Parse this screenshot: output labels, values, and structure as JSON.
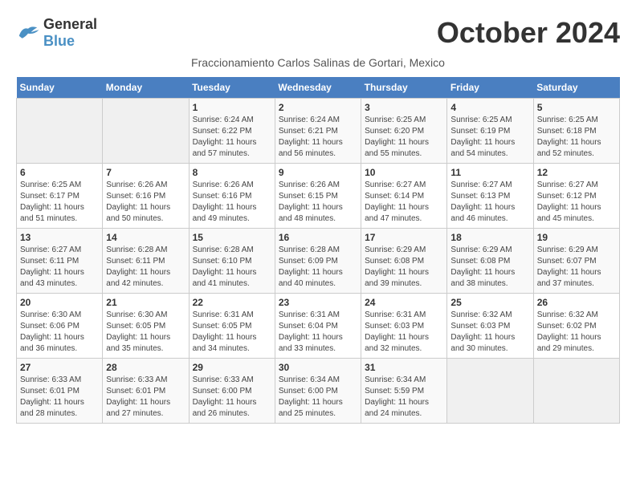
{
  "logo": {
    "line1": "General",
    "line2": "Blue"
  },
  "title": "October 2024",
  "subtitle": "Fraccionamiento Carlos Salinas de Gortari, Mexico",
  "days_of_week": [
    "Sunday",
    "Monday",
    "Tuesday",
    "Wednesday",
    "Thursday",
    "Friday",
    "Saturday"
  ],
  "weeks": [
    [
      {
        "day": "",
        "sunrise": "",
        "sunset": "",
        "daylight": ""
      },
      {
        "day": "",
        "sunrise": "",
        "sunset": "",
        "daylight": ""
      },
      {
        "day": "1",
        "sunrise": "Sunrise: 6:24 AM",
        "sunset": "Sunset: 6:22 PM",
        "daylight": "Daylight: 11 hours and 57 minutes."
      },
      {
        "day": "2",
        "sunrise": "Sunrise: 6:24 AM",
        "sunset": "Sunset: 6:21 PM",
        "daylight": "Daylight: 11 hours and 56 minutes."
      },
      {
        "day": "3",
        "sunrise": "Sunrise: 6:25 AM",
        "sunset": "Sunset: 6:20 PM",
        "daylight": "Daylight: 11 hours and 55 minutes."
      },
      {
        "day": "4",
        "sunrise": "Sunrise: 6:25 AM",
        "sunset": "Sunset: 6:19 PM",
        "daylight": "Daylight: 11 hours and 54 minutes."
      },
      {
        "day": "5",
        "sunrise": "Sunrise: 6:25 AM",
        "sunset": "Sunset: 6:18 PM",
        "daylight": "Daylight: 11 hours and 52 minutes."
      }
    ],
    [
      {
        "day": "6",
        "sunrise": "Sunrise: 6:25 AM",
        "sunset": "Sunset: 6:17 PM",
        "daylight": "Daylight: 11 hours and 51 minutes."
      },
      {
        "day": "7",
        "sunrise": "Sunrise: 6:26 AM",
        "sunset": "Sunset: 6:16 PM",
        "daylight": "Daylight: 11 hours and 50 minutes."
      },
      {
        "day": "8",
        "sunrise": "Sunrise: 6:26 AM",
        "sunset": "Sunset: 6:16 PM",
        "daylight": "Daylight: 11 hours and 49 minutes."
      },
      {
        "day": "9",
        "sunrise": "Sunrise: 6:26 AM",
        "sunset": "Sunset: 6:15 PM",
        "daylight": "Daylight: 11 hours and 48 minutes."
      },
      {
        "day": "10",
        "sunrise": "Sunrise: 6:27 AM",
        "sunset": "Sunset: 6:14 PM",
        "daylight": "Daylight: 11 hours and 47 minutes."
      },
      {
        "day": "11",
        "sunrise": "Sunrise: 6:27 AM",
        "sunset": "Sunset: 6:13 PM",
        "daylight": "Daylight: 11 hours and 46 minutes."
      },
      {
        "day": "12",
        "sunrise": "Sunrise: 6:27 AM",
        "sunset": "Sunset: 6:12 PM",
        "daylight": "Daylight: 11 hours and 45 minutes."
      }
    ],
    [
      {
        "day": "13",
        "sunrise": "Sunrise: 6:27 AM",
        "sunset": "Sunset: 6:11 PM",
        "daylight": "Daylight: 11 hours and 43 minutes."
      },
      {
        "day": "14",
        "sunrise": "Sunrise: 6:28 AM",
        "sunset": "Sunset: 6:11 PM",
        "daylight": "Daylight: 11 hours and 42 minutes."
      },
      {
        "day": "15",
        "sunrise": "Sunrise: 6:28 AM",
        "sunset": "Sunset: 6:10 PM",
        "daylight": "Daylight: 11 hours and 41 minutes."
      },
      {
        "day": "16",
        "sunrise": "Sunrise: 6:28 AM",
        "sunset": "Sunset: 6:09 PM",
        "daylight": "Daylight: 11 hours and 40 minutes."
      },
      {
        "day": "17",
        "sunrise": "Sunrise: 6:29 AM",
        "sunset": "Sunset: 6:08 PM",
        "daylight": "Daylight: 11 hours and 39 minutes."
      },
      {
        "day": "18",
        "sunrise": "Sunrise: 6:29 AM",
        "sunset": "Sunset: 6:08 PM",
        "daylight": "Daylight: 11 hours and 38 minutes."
      },
      {
        "day": "19",
        "sunrise": "Sunrise: 6:29 AM",
        "sunset": "Sunset: 6:07 PM",
        "daylight": "Daylight: 11 hours and 37 minutes."
      }
    ],
    [
      {
        "day": "20",
        "sunrise": "Sunrise: 6:30 AM",
        "sunset": "Sunset: 6:06 PM",
        "daylight": "Daylight: 11 hours and 36 minutes."
      },
      {
        "day": "21",
        "sunrise": "Sunrise: 6:30 AM",
        "sunset": "Sunset: 6:05 PM",
        "daylight": "Daylight: 11 hours and 35 minutes."
      },
      {
        "day": "22",
        "sunrise": "Sunrise: 6:31 AM",
        "sunset": "Sunset: 6:05 PM",
        "daylight": "Daylight: 11 hours and 34 minutes."
      },
      {
        "day": "23",
        "sunrise": "Sunrise: 6:31 AM",
        "sunset": "Sunset: 6:04 PM",
        "daylight": "Daylight: 11 hours and 33 minutes."
      },
      {
        "day": "24",
        "sunrise": "Sunrise: 6:31 AM",
        "sunset": "Sunset: 6:03 PM",
        "daylight": "Daylight: 11 hours and 32 minutes."
      },
      {
        "day": "25",
        "sunrise": "Sunrise: 6:32 AM",
        "sunset": "Sunset: 6:03 PM",
        "daylight": "Daylight: 11 hours and 30 minutes."
      },
      {
        "day": "26",
        "sunrise": "Sunrise: 6:32 AM",
        "sunset": "Sunset: 6:02 PM",
        "daylight": "Daylight: 11 hours and 29 minutes."
      }
    ],
    [
      {
        "day": "27",
        "sunrise": "Sunrise: 6:33 AM",
        "sunset": "Sunset: 6:01 PM",
        "daylight": "Daylight: 11 hours and 28 minutes."
      },
      {
        "day": "28",
        "sunrise": "Sunrise: 6:33 AM",
        "sunset": "Sunset: 6:01 PM",
        "daylight": "Daylight: 11 hours and 27 minutes."
      },
      {
        "day": "29",
        "sunrise": "Sunrise: 6:33 AM",
        "sunset": "Sunset: 6:00 PM",
        "daylight": "Daylight: 11 hours and 26 minutes."
      },
      {
        "day": "30",
        "sunrise": "Sunrise: 6:34 AM",
        "sunset": "Sunset: 6:00 PM",
        "daylight": "Daylight: 11 hours and 25 minutes."
      },
      {
        "day": "31",
        "sunrise": "Sunrise: 6:34 AM",
        "sunset": "Sunset: 5:59 PM",
        "daylight": "Daylight: 11 hours and 24 minutes."
      },
      {
        "day": "",
        "sunrise": "",
        "sunset": "",
        "daylight": ""
      },
      {
        "day": "",
        "sunrise": "",
        "sunset": "",
        "daylight": ""
      }
    ]
  ]
}
